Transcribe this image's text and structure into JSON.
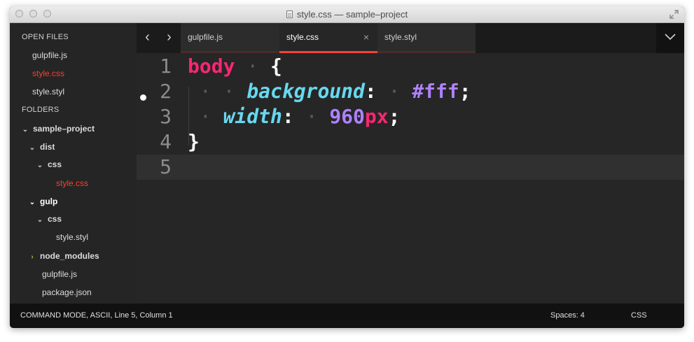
{
  "window": {
    "title": "style.css — sample–project"
  },
  "sidebar": {
    "open_files_heading": "OPEN FILES",
    "open_files": [
      {
        "label": "gulpfile.js"
      },
      {
        "label": "style.css"
      },
      {
        "label": "style.styl"
      }
    ],
    "folders_heading": "FOLDERS",
    "tree": [
      {
        "label": "sample–project",
        "expanded": true
      },
      {
        "label": "dist",
        "expanded": true
      },
      {
        "label": "css",
        "expanded": true
      },
      {
        "label": "style.css"
      },
      {
        "label": "gulp",
        "expanded": true
      },
      {
        "label": "css",
        "expanded": true
      },
      {
        "label": "style.styl"
      },
      {
        "label": "node_modules",
        "expanded": false
      },
      {
        "label": "gulpfile.js"
      },
      {
        "label": "package.json"
      }
    ]
  },
  "tabs": [
    {
      "label": "gulpfile.js",
      "active": false
    },
    {
      "label": "style.css",
      "active": true,
      "close": "×"
    },
    {
      "label": "style.styl",
      "active": false
    }
  ],
  "nav": {
    "back": "‹",
    "forward": "›"
  },
  "editor": {
    "line_numbers": [
      "1",
      "2",
      "3",
      "4",
      "5"
    ],
    "modified_line": 2,
    "current_line": 5,
    "code": {
      "line1": {
        "selector": "body",
        "ws": " · ",
        "brace": "{"
      },
      "line2": {
        "indent": " · · ",
        "property": "background",
        "colon": ":",
        "ws": " · ",
        "value": "#fff",
        "semicolon": ";"
      },
      "line3": {
        "indent": " · ",
        "property": "width",
        "colon": ":",
        "ws": " · ",
        "number": "960",
        "unit": "px",
        "semicolon": ";"
      },
      "line4": {
        "brace": "}"
      }
    }
  },
  "status": {
    "left": "COMMAND MODE, ASCII, Line 5, Column 1",
    "spaces": "Spaces: 4",
    "syntax": "CSS"
  },
  "colors": {
    "selector": "#f92672",
    "property": "#66d9ef",
    "value": "#ae81ff",
    "unit": "#f92672",
    "active_tab_accent": "#ff4136",
    "open_file_highlight": "#ff3d2e",
    "collapsed_arrow": "#9acd32"
  },
  "icons": {
    "traffic_lights": [
      "close-button",
      "minimize-button",
      "zoom-button"
    ],
    "title_icon": "document-icon",
    "fullscreen": "fullscreen-icon",
    "dropdown": "chevron-down-icon"
  }
}
